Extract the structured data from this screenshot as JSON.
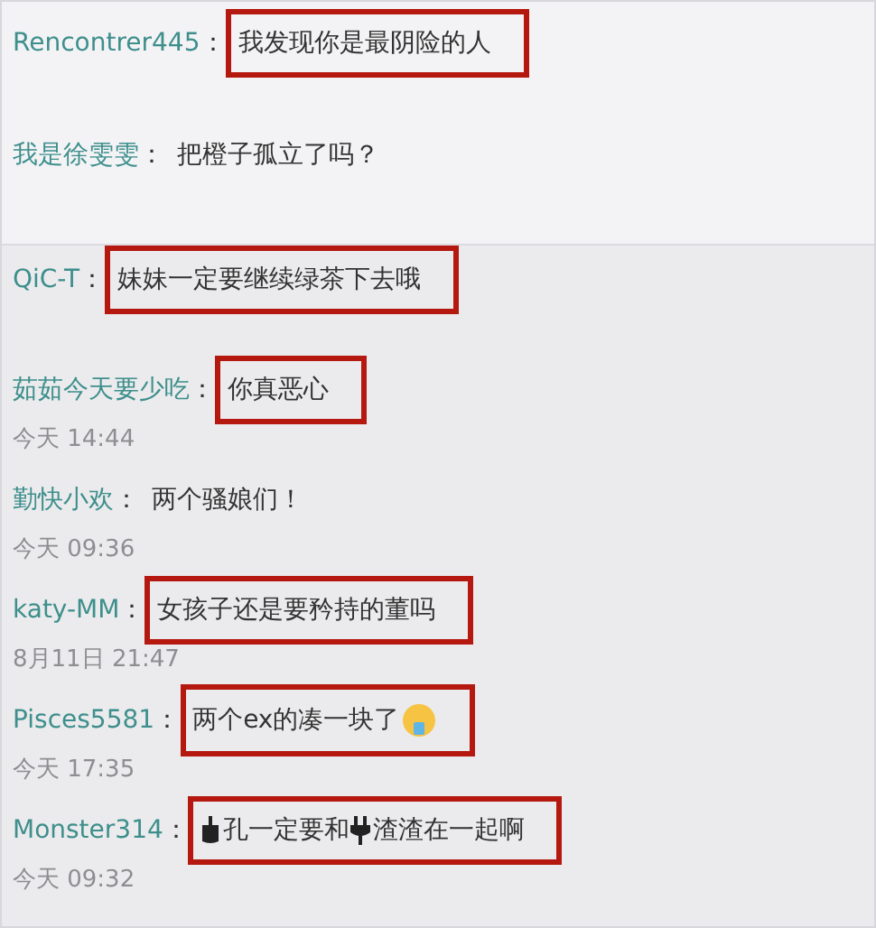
{
  "comments": [
    {
      "user": "Rencontrer445",
      "colon": "：",
      "highlighted": true,
      "parts": [
        {
          "kind": "text",
          "text": "我发现你是最阴险的人"
        }
      ]
    },
    {
      "user": "我是徐雯雯",
      "colon": "：",
      "highlighted": false,
      "parts": [
        {
          "kind": "text",
          "text": "把橙子孤立了吗？"
        }
      ]
    },
    {
      "user": "QiC-T",
      "colon": "：",
      "highlighted": true,
      "parts": [
        {
          "kind": "text",
          "text": "妹妹一定要继续绿茶下去哦"
        }
      ]
    },
    {
      "user": "茹茹今天要少吃",
      "colon": "：",
      "highlighted": true,
      "time": "今天 14:44",
      "parts": [
        {
          "kind": "text",
          "text": "你真恶心"
        }
      ]
    },
    {
      "user": "勤快小欢",
      "colon": "：",
      "highlighted": false,
      "time": "今天 09:36",
      "parts": [
        {
          "kind": "text",
          "text": "两个骚娘们！"
        }
      ]
    },
    {
      "user": "katy-MM",
      "colon": "：",
      "highlighted": true,
      "time": "8月11日 21:47",
      "parts": [
        {
          "kind": "text",
          "text": "女孩子还是要矜持的董吗"
        }
      ]
    },
    {
      "user": "Pisces5581",
      "colon": "：",
      "highlighted": true,
      "time": "今天 17:35",
      "parts": [
        {
          "kind": "text",
          "text": "两个ex的凑一块了"
        },
        {
          "kind": "emoji"
        }
      ]
    },
    {
      "user": "Monster314",
      "colon": "：",
      "highlighted": true,
      "time": "今天 09:32",
      "parts": [
        {
          "kind": "socket"
        },
        {
          "kind": "text",
          "text": "孔一定要和"
        },
        {
          "kind": "plug"
        },
        {
          "kind": "text",
          "text": "渣渣在一起啊"
        }
      ]
    }
  ]
}
